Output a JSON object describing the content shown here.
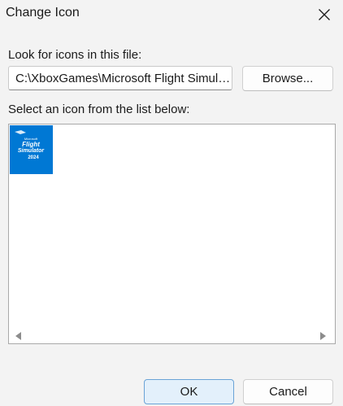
{
  "window": {
    "title": "Change Icon"
  },
  "file": {
    "label": "Look for icons in this file:",
    "value": "C:\\XboxGames\\Microsoft Flight Simul…",
    "browse_label": "Browse..."
  },
  "list": {
    "label": "Select an icon from the list below:",
    "items": [
      {
        "icon": "microsoft-flight-simulator-2024-icon",
        "text_small": "Microsoft",
        "text_line1": "Flight",
        "text_line2": "Simulator",
        "text_line3": "2024",
        "bg_color": "#0078d4"
      }
    ]
  },
  "footer": {
    "ok_label": "OK",
    "cancel_label": "Cancel"
  },
  "colors": {
    "accent": "#0078d4",
    "ok_bg": "#e3f0fb",
    "ok_border": "#6aa3d6"
  }
}
